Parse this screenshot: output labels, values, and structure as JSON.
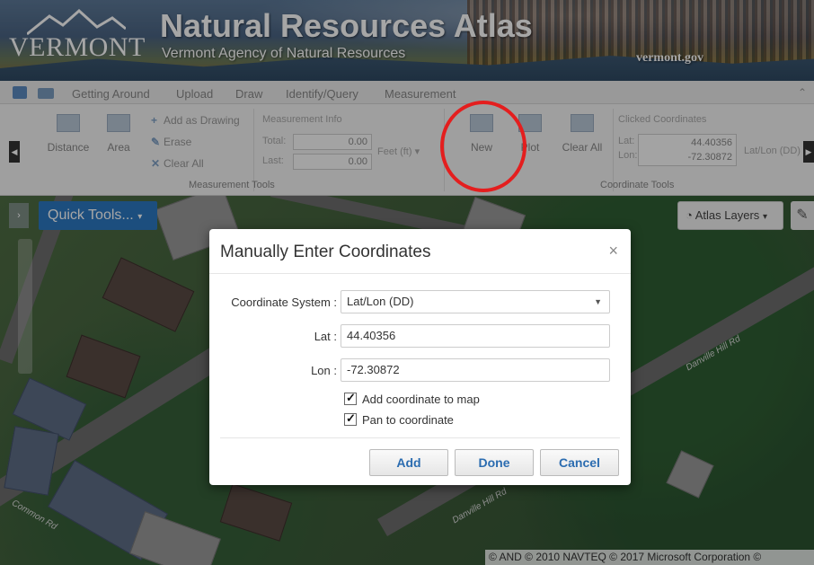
{
  "banner": {
    "logo_text": "VERMONT",
    "title": "Natural Resources Atlas",
    "subtitle": "Vermont Agency of Natural Resources",
    "site": "vermont.gov"
  },
  "ribbon": {
    "tabs": [
      "Getting Around",
      "Upload",
      "Draw",
      "Identify/Query",
      "Measurement"
    ],
    "measurement": {
      "distance": "Distance",
      "area": "Area",
      "add_as_drawing": "Add as Drawing",
      "erase": "Erase",
      "clear_all": "Clear All",
      "info_header": "Measurement Info",
      "total_label": "Total:",
      "total_value": "0.00",
      "last_label": "Last:",
      "last_value": "0.00",
      "unit": "Feet (ft)",
      "group_label": "Measurement Tools"
    },
    "coordinate": {
      "new": "New",
      "plot": "Plot",
      "clear_all": "Clear All",
      "clicked_header": "Clicked Coordinates",
      "lat_label": "Lat:",
      "lat_value": "44.40356",
      "lon_label": "Lon:",
      "lon_value": "-72.30872",
      "system": "Lat/Lon (DD)",
      "group_label": "Coordinate Tools"
    }
  },
  "map": {
    "quick_tools": "Quick Tools...",
    "atlas_layers": "Atlas Layers",
    "road_labels": [
      "Danville Hill Rd",
      "Danville Hill Rd",
      "Common Rd"
    ],
    "attribution": "© AND © 2010 NAVTEQ © 2017 Microsoft Corporation ©"
  },
  "modal": {
    "title": "Manually Enter Coordinates",
    "close": "×",
    "coord_system_label": "Coordinate System :",
    "coord_system_value": "Lat/Lon (DD)",
    "lat_label": "Lat :",
    "lat_value": "44.40356",
    "lon_label": "Lon :",
    "lon_value": "-72.30872",
    "add_to_map": "Add coordinate to map",
    "add_to_map_checked": true,
    "pan_to": "Pan to coordinate",
    "pan_to_checked": true,
    "buttons": {
      "add": "Add",
      "done": "Done",
      "cancel": "Cancel"
    }
  }
}
